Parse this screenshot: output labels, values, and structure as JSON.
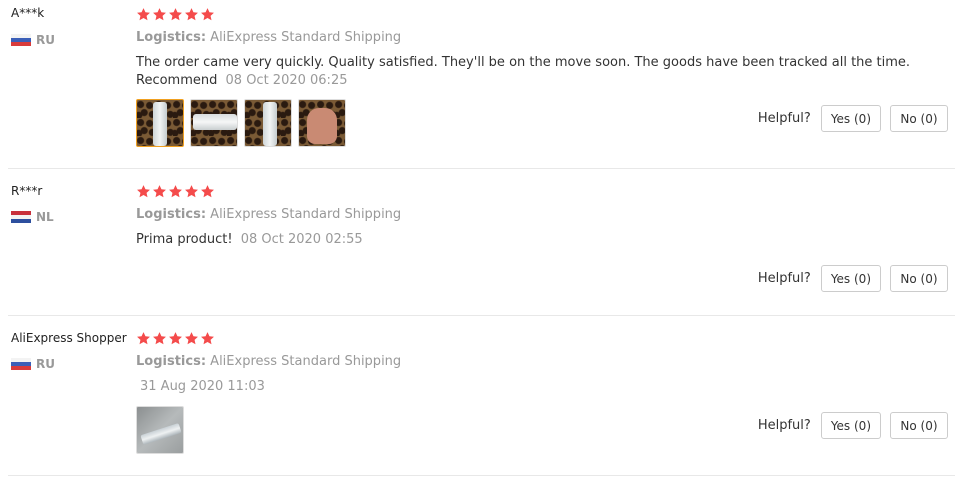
{
  "colors": {
    "star": "#f44b4b",
    "muted": "#999999",
    "text": "#333333",
    "selected_border": "#f0a020"
  },
  "helpful_label": "Helpful?",
  "reviews": [
    {
      "name": "A***k",
      "country": "RU",
      "flag": "russia-flag-icon",
      "rating": 5,
      "logistics_label": "Logistics:",
      "logistics_value": "AliExpress Standard Shipping",
      "text": "The order came very quickly. Quality satisfied. They'll be on the move soon. The goods have been tracked all the time.",
      "text2": "Recommend",
      "date": "08 Oct 2020 06:25",
      "photos": 4,
      "yes": "Yes (0)",
      "no": "No (0)"
    },
    {
      "name": "R***r",
      "country": "NL",
      "flag": "netherlands-flag-icon",
      "rating": 5,
      "logistics_label": "Logistics:",
      "logistics_value": "AliExpress Standard Shipping",
      "text": "Prima product!",
      "date": "08 Oct 2020 02:55",
      "photos": 0,
      "yes": "Yes (0)",
      "no": "No (0)"
    },
    {
      "name": "AliExpress Shopper",
      "country": "RU",
      "flag": "russia-flag-icon",
      "rating": 5,
      "logistics_label": "Logistics:",
      "logistics_value": "AliExpress Standard Shipping",
      "text": "",
      "date": "31 Aug 2020 11:03",
      "photos": 1,
      "yes": "Yes (0)",
      "no": "No (0)"
    }
  ]
}
